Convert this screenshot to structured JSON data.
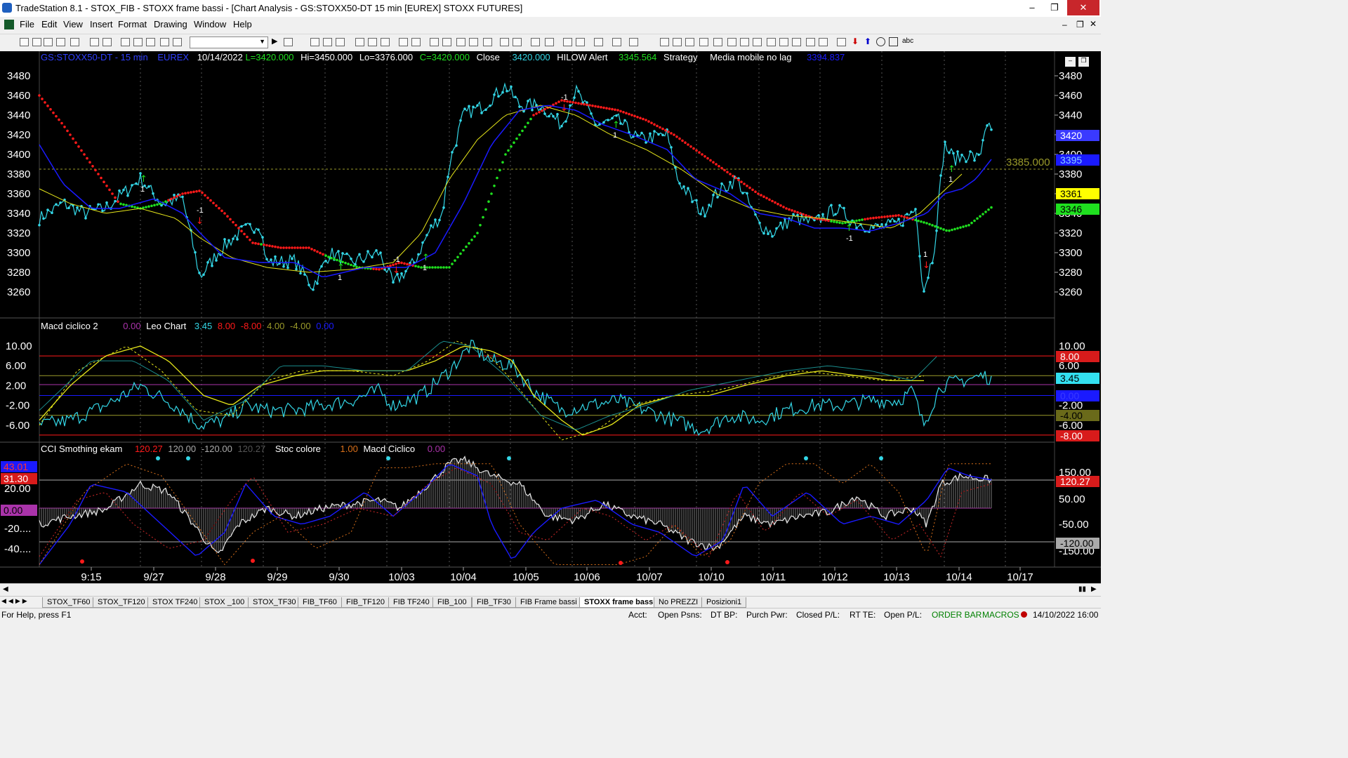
{
  "window": {
    "title": "TradeStation 8.1 - STOX_FIB - STOXX frame bassi - [Chart Analysis - GS:STOXX50-DT  15 min  [EUREX] STOXX FUTURES]",
    "min": "–",
    "max": "❐",
    "close": "✕"
  },
  "menu": [
    "File",
    "Edit",
    "View",
    "Insert",
    "Format",
    "Drawing",
    "Window",
    "Help"
  ],
  "price_panel": {
    "symbol": "GS:STOXX50-DT - 15 min",
    "exchange": "EUREX",
    "date": "10/14/2022",
    "last": "L=3420.000",
    "high": "Hi=3450.000",
    "low": "Lo=3376.000",
    "close_eq": "C=3420.000",
    "close_word": "Close",
    "close_val": "3420.000",
    "hilow": "HILOW Alert",
    "hilow_val": "3345.564",
    "strategy": "Strategy",
    "mm": "Media mobile no lag",
    "mm_val": "3394.837",
    "hline": "3385.000",
    "axis": [
      "3480",
      "3460",
      "3440",
      "3420",
      "3400",
      "3380",
      "3360",
      "3340",
      "3320",
      "3300",
      "3280",
      "3260"
    ],
    "tags": [
      "3420",
      "3395",
      "3361",
      "3346"
    ]
  },
  "macd_panel": {
    "label": "Macd ciclico 2",
    "v1": "0.00",
    "leo": "Leo Chart",
    "v2": "3.45",
    "v3": "8.00",
    "v4": "-8.00",
    "v5": "4.00",
    "v6": "-4.00",
    "v7": "0.00",
    "axis": [
      "10.00",
      "6.00",
      "2.00",
      "-2.00",
      "-6.00"
    ],
    "raxis": [
      "10.00",
      "6.00",
      "-2.00",
      "-6.00"
    ],
    "tags": [
      "8.00",
      "3.45",
      "0.00",
      "-4.00",
      "-8.00"
    ]
  },
  "cci_panel": {
    "label": "CCI Smothing ekam",
    "v1": "120.27",
    "v2": "120.00",
    "v3": "-120.00",
    "v4": "120.27",
    "stoc": "Stoc colore",
    "stoc_val": "1.00",
    "macd": "Macd Ciclico",
    "macd_val": "0.00",
    "axis": [
      "20.00",
      "-20....",
      "-40...."
    ],
    "raxis": [
      "150.00",
      "50.00",
      "-50.00",
      "-150.00"
    ],
    "tags": [
      "120.27",
      "-120.00"
    ],
    "left_tags": [
      "43.01",
      "31.30",
      "0.00"
    ]
  },
  "signals": [
    "1",
    "-1",
    "1",
    "-1",
    "1",
    "-1",
    "1",
    "-1",
    "1",
    "1"
  ],
  "dates": [
    "9:15",
    "9/27",
    "9/28",
    "9/29",
    "9/30",
    "10/03",
    "10/04",
    "10/05",
    "10/06",
    "10/07",
    "10/10",
    "10/11",
    "10/12",
    "10/13",
    "10/14",
    "10/17"
  ],
  "tabs": [
    "STOX_TF60",
    "STOX_TF120",
    "STOX TF240",
    "STOX _100",
    "STOX_TF30",
    "FIB_TF60",
    "FIB_TF120",
    "FIB TF240",
    "FIB_100",
    "FIB_TF30",
    "FIB Frame bassi",
    "STOXX frame bassi",
    "No PREZZI",
    "Posizioni1"
  ],
  "status": {
    "help": "For Help, press F1",
    "acct": "Acct:",
    "open_psns": "Open Psns:",
    "dtbp": "DT BP:",
    "purch": "Purch Pwr:",
    "closed": "Closed P/L:",
    "rte": "RT TE:",
    "openpl": "Open P/L:",
    "orderbar": "ORDER BAR",
    "macros": "MACROS",
    "datetime": "14/10/2022 16:00"
  },
  "colors": {
    "cyan": "#33d6e6",
    "red": "#ff1a1a",
    "green": "#1fe01f",
    "blue": "#1a1aff",
    "yellow": "#e6e61a",
    "olive": "#9a9a2a",
    "purple": "#aa33aa"
  }
}
